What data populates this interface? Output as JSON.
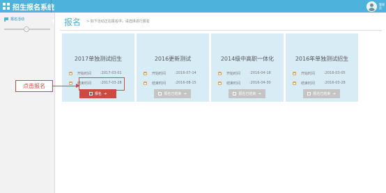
{
  "app": {
    "title": "招生报名系统",
    "user_line1": "管理",
    "user_line2": "员"
  },
  "sidebar": {
    "item_label": "报名活动",
    "slider_knob": "‹›"
  },
  "page": {
    "title": "报名",
    "subtitle": "> 如下活动正在报名中，请选择进行报名"
  },
  "labels": {
    "start": "开始时间",
    "end": "结束时间"
  },
  "cards": [
    {
      "title": "2017单独测试招生",
      "start": ":2017-03-01",
      "end": ":2017-03-28",
      "button": "报名",
      "button_state": "active"
    },
    {
      "title": "2016更新测试",
      "start": ":2016-07-14",
      "end": ":2016-08-15",
      "button": "报名已结束",
      "button_state": "disabled"
    },
    {
      "title": "2014级中高职一体化",
      "start": ":2016-04-18",
      "end": ":2016-04-30",
      "button": "报名已结束",
      "button_state": "disabled"
    },
    {
      "title": "2016年单独测试招生",
      "start": ":2016-03-05",
      "end": ":2016-03-28",
      "button": "报名已结束",
      "button_state": "disabled"
    }
  ],
  "annotation": {
    "callout": "点击报名"
  },
  "colors": {
    "topbar": "#4db3dd",
    "card": "#d8ecf6",
    "accent": "#cd4a42",
    "disabled": "#c4c4c4"
  }
}
